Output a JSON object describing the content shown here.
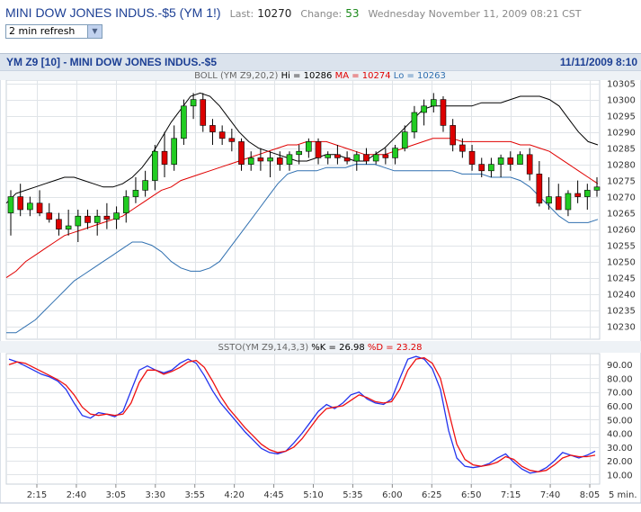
{
  "header": {
    "symbol": "MINI DOW JONES INDUS.-$5 (YM 1!)",
    "last_label": "Last:",
    "last_value": "10270",
    "change_label": "Change:",
    "change_value": "53",
    "datetime": "Wednesday November 11, 2009 08:21 CST"
  },
  "refresh_select": {
    "value": "2 min refresh"
  },
  "chart_title": {
    "left": "YM Z9 [10] - MINI DOW JONES INDUS.-$5",
    "right": "11/11/2009 8:10"
  },
  "chart_data": [
    {
      "type": "candlestick",
      "title": "BOLL (YM Z9,20,2)",
      "legend": [
        {
          "text": "Hi = 10286",
          "color": "#000000"
        },
        {
          "text": "MA = 10274",
          "color": "#e00000"
        },
        {
          "text": "Lo = 10263",
          "color": "#3070b0"
        }
      ],
      "ylim": [
        10226,
        10306
      ],
      "y_ticks": [
        10230,
        10235,
        10240,
        10245,
        10250,
        10255,
        10260,
        10265,
        10270,
        10275,
        10280,
        10285,
        10290,
        10295,
        10300,
        10305
      ],
      "candles": [
        [
          10265,
          10272,
          10258,
          10270
        ],
        [
          10270,
          10274,
          10264,
          10266
        ],
        [
          10266,
          10270,
          10264,
          10268
        ],
        [
          10268,
          10272,
          10264,
          10265
        ],
        [
          10265,
          10268,
          10262,
          10263
        ],
        [
          10263,
          10265,
          10258,
          10260
        ],
        [
          10260,
          10266,
          10258,
          10261
        ],
        [
          10261,
          10266,
          10256,
          10264
        ],
        [
          10264,
          10266,
          10260,
          10262
        ],
        [
          10262,
          10266,
          10258,
          10264
        ],
        [
          10264,
          10268,
          10260,
          10263
        ],
        [
          10263,
          10267,
          10260,
          10265
        ],
        [
          10265,
          10272,
          10262,
          10270
        ],
        [
          10270,
          10276,
          10268,
          10272
        ],
        [
          10272,
          10278,
          10270,
          10275
        ],
        [
          10275,
          10286,
          10272,
          10284
        ],
        [
          10284,
          10290,
          10276,
          10280
        ],
        [
          10280,
          10292,
          10278,
          10288
        ],
        [
          10288,
          10300,
          10286,
          10298
        ],
        [
          10298,
          10302,
          10294,
          10300
        ],
        [
          10300,
          10302,
          10290,
          10292
        ],
        [
          10292,
          10294,
          10286,
          10290
        ],
        [
          10290,
          10292,
          10286,
          10288
        ],
        [
          10288,
          10291,
          10284,
          10287
        ],
        [
          10287,
          10288,
          10278,
          10280
        ],
        [
          10280,
          10284,
          10278,
          10282
        ],
        [
          10282,
          10285,
          10278,
          10281
        ],
        [
          10281,
          10284,
          10276,
          10282
        ],
        [
          10282,
          10284,
          10278,
          10280
        ],
        [
          10280,
          10284,
          10278,
          10283
        ],
        [
          10283,
          10286,
          10280,
          10284
        ],
        [
          10284,
          10288,
          10282,
          10287
        ],
        [
          10287,
          10288,
          10280,
          10282
        ],
        [
          10282,
          10284,
          10280,
          10283
        ],
        [
          10283,
          10286,
          10280,
          10282
        ],
        [
          10282,
          10284,
          10280,
          10281
        ],
        [
          10281,
          10284,
          10278,
          10283
        ],
        [
          10283,
          10285,
          10280,
          10281
        ],
        [
          10281,
          10284,
          10280,
          10283
        ],
        [
          10283,
          10285,
          10280,
          10282
        ],
        [
          10282,
          10286,
          10280,
          10285
        ],
        [
          10285,
          10292,
          10284,
          10290
        ],
        [
          10290,
          10298,
          10288,
          10296
        ],
        [
          10296,
          10300,
          10292,
          10298
        ],
        [
          10298,
          10302,
          10296,
          10300
        ],
        [
          10300,
          10301,
          10290,
          10292
        ],
        [
          10292,
          10294,
          10284,
          10286
        ],
        [
          10286,
          10288,
          10282,
          10284
        ],
        [
          10284,
          10286,
          10278,
          10280
        ],
        [
          10280,
          10282,
          10276,
          10278
        ],
        [
          10278,
          10282,
          10276,
          10280
        ],
        [
          10280,
          10283,
          10276,
          10282
        ],
        [
          10282,
          10284,
          10278,
          10280
        ],
        [
          10280,
          10284,
          10280,
          10283
        ],
        [
          10283,
          10285,
          10275,
          10277
        ],
        [
          10277,
          10281,
          10267,
          10268
        ],
        [
          10268,
          10276,
          10266,
          10270
        ],
        [
          10270,
          10274,
          10266,
          10266
        ],
        [
          10266,
          10272,
          10264,
          10271
        ],
        [
          10271,
          10275,
          10268,
          10270
        ],
        [
          10270,
          10274,
          10266,
          10272
        ],
        [
          10272,
          10276,
          10270,
          10273
        ]
      ],
      "series": [
        {
          "values": [
            10268,
            10271,
            10272,
            10273,
            10274,
            10275,
            10276,
            10276,
            10275,
            10274,
            10273,
            10273,
            10274,
            10276,
            10279,
            10283,
            10288,
            10293,
            10297,
            10301,
            10302,
            10301,
            10298,
            10294,
            10290,
            10287,
            10285,
            10284,
            10283,
            10282,
            10281,
            10281,
            10282,
            10283,
            10283,
            10282,
            10281,
            10281,
            10283,
            10285,
            10288,
            10291,
            10294,
            10297,
            10298,
            10298,
            10298,
            10298,
            10298,
            10299,
            10299,
            10299,
            10300,
            10301,
            10301,
            10301,
            10300,
            10298,
            10294,
            10290,
            10287,
            10286
          ]
        },
        {
          "values": [
            10245,
            10247,
            10250,
            10252,
            10254,
            10256,
            10258,
            10259,
            10260,
            10261,
            10262,
            10263,
            10264,
            10266,
            10268,
            10270,
            10272,
            10273,
            10275,
            10276,
            10277,
            10278,
            10279,
            10280,
            10281,
            10282,
            10283,
            10284,
            10285,
            10286,
            10286,
            10287,
            10287,
            10287,
            10286,
            10285,
            10284,
            10283,
            10283,
            10283,
            10284,
            10285,
            10286,
            10287,
            10288,
            10288,
            10288,
            10287,
            10287,
            10287,
            10287,
            10287,
            10287,
            10286,
            10286,
            10285,
            10284,
            10282,
            10280,
            10278,
            10276,
            10274
          ]
        },
        {
          "values": [
            10228,
            10228,
            10230,
            10232,
            10235,
            10238,
            10241,
            10244,
            10246,
            10248,
            10250,
            10252,
            10254,
            10256,
            10256,
            10255,
            10253,
            10250,
            10248,
            10247,
            10247,
            10248,
            10250,
            10254,
            10258,
            10262,
            10266,
            10270,
            10274,
            10277,
            10278,
            10278,
            10278,
            10279,
            10279,
            10279,
            10280,
            10280,
            10280,
            10279,
            10278,
            10278,
            10278,
            10278,
            10278,
            10278,
            10278,
            10277,
            10277,
            10277,
            10276,
            10276,
            10276,
            10275,
            10273,
            10270,
            10267,
            10264,
            10262,
            10262,
            10262,
            10263
          ]
        }
      ]
    },
    {
      "type": "line",
      "title": "SSTO(YM Z9,14,3,3)",
      "legend": [
        {
          "text": "%K = 26.98",
          "color": "#000000"
        },
        {
          "text": "%D = 23.28",
          "color": "#e00000"
        }
      ],
      "ylim": [
        3,
        98
      ],
      "y_ticks": [
        10,
        20,
        30,
        40,
        50,
        60,
        70,
        80,
        90
      ],
      "y_tick_labels": [
        "10.00",
        "20.00",
        "30.00",
        "40.00",
        "50.00",
        "60.00",
        "70.00",
        "80.00",
        "90.00"
      ],
      "x_ticks": [
        "2:15",
        "2:40",
        "3:05",
        "3:30",
        "3:55",
        "4:20",
        "4:45",
        "5:10",
        "5:35",
        "6:00",
        "6:25",
        "6:50",
        "7:15",
        "7:40",
        "8:05"
      ],
      "x_unit": "5 min.",
      "series": [
        {
          "values": [
            94,
            92,
            89,
            86,
            83,
            81,
            78,
            72,
            62,
            53,
            51,
            55,
            54,
            52,
            56,
            71,
            86,
            89,
            86,
            84,
            86,
            91,
            94,
            91,
            82,
            71,
            62,
            55,
            48,
            41,
            35,
            29,
            26,
            25,
            27,
            33,
            40,
            48,
            56,
            61,
            58,
            62,
            68,
            70,
            65,
            62,
            61,
            65,
            80,
            94,
            96,
            94,
            87,
            72,
            42,
            22,
            16,
            15,
            16,
            18,
            22,
            25,
            19,
            14,
            11,
            12,
            15,
            20,
            26,
            24,
            22,
            24,
            27
          ]
        },
        {
          "values": [
            90,
            92,
            91,
            88,
            85,
            82,
            79,
            75,
            68,
            59,
            54,
            53,
            54,
            53,
            54,
            62,
            77,
            86,
            86,
            83,
            85,
            88,
            92,
            93,
            88,
            78,
            67,
            58,
            51,
            44,
            38,
            32,
            28,
            26,
            27,
            30,
            36,
            44,
            52,
            58,
            59,
            60,
            64,
            68,
            66,
            63,
            62,
            63,
            72,
            86,
            94,
            95,
            91,
            80,
            56,
            32,
            21,
            17,
            16,
            17,
            19,
            23,
            21,
            16,
            13,
            12,
            13,
            17,
            22,
            24,
            23,
            23,
            24
          ]
        }
      ]
    }
  ]
}
